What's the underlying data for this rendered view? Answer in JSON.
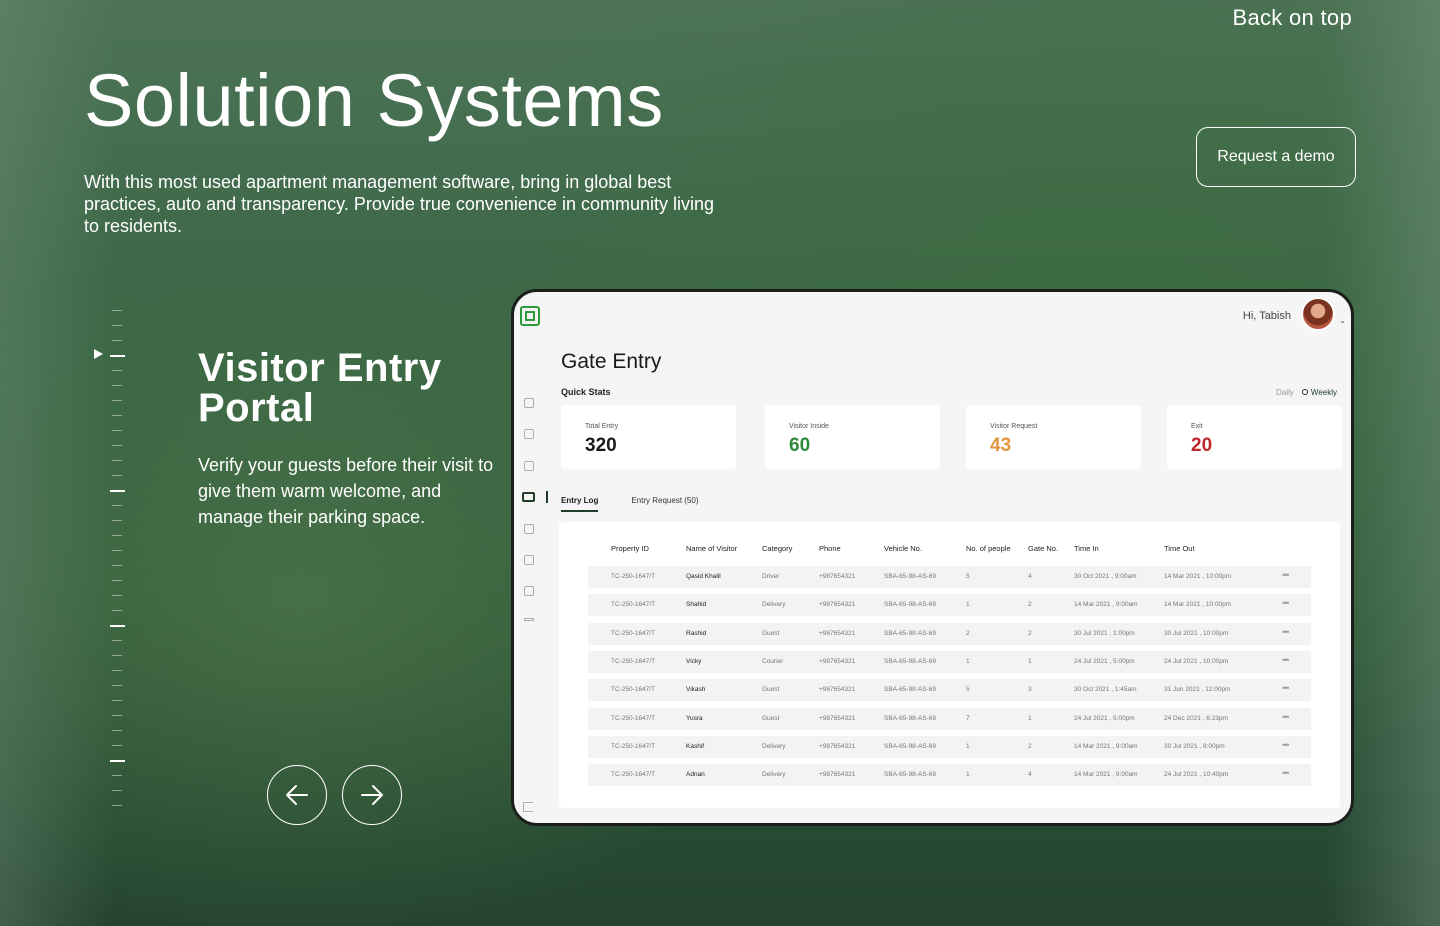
{
  "header": {
    "back_label": "Back on top",
    "title": "Solution Systems",
    "description": "With this most used apartment management software, bring in global best practices, auto and transparency. Provide true convenience in community living to residents.",
    "demo_label": "Request a demo"
  },
  "feature": {
    "title": "Visitor Entry Portal",
    "description": "Verify your guests before their visit to give them warm welcome, and manage their parking space."
  },
  "app": {
    "greeting": "Hi, Tabish",
    "title": "Gate Entry",
    "quick_stats_label": "Quick Stats",
    "period": {
      "daily": "Daily",
      "weekly": "Weekly",
      "selected": "Weekly"
    },
    "stats": [
      {
        "label": "Total Entry",
        "value": "320",
        "color": "#1a1a1a"
      },
      {
        "label": "Visitor Inside",
        "value": "60",
        "color": "#2e8b3a"
      },
      {
        "label": "Visitor Request",
        "value": "43",
        "color": "#e0953f"
      },
      {
        "label": "Exit",
        "value": "20",
        "color": "#c0272d"
      }
    ],
    "tabs": [
      "Entry Log",
      "Entry Request (50)"
    ],
    "active_tab": "Entry Log",
    "columns": [
      "Property ID",
      "Name of Visitor",
      "Category",
      "Phone",
      "Vehicle No.",
      "No. of people",
      "Gate No.",
      "Time In",
      "Time Out"
    ],
    "rows": [
      [
        "TC-250-1647/T",
        "Qasid Khalil",
        "Driver",
        "+987654321",
        "SBA-65-98-AS-69",
        "5",
        "4",
        "30 Oct 2021 , 9:00am",
        "14 Mar 2021 , 10:00pm"
      ],
      [
        "TC-250-1647/T",
        "Shahid",
        "Delivery",
        "+987654321",
        "SBA-65-98-AS-69",
        "1",
        "2",
        "14 Mar 2021 , 9:00am",
        "14 Mar 2021 , 10:00pm"
      ],
      [
        "TC-250-1647/T",
        "Rashid",
        "Guest",
        "+987654321",
        "SBA-65-98-AS-69",
        "2",
        "2",
        "30 Jul 2021 , 1:00pm",
        "30 Jul 2021 , 10:00pm"
      ],
      [
        "TC-250-1647/T",
        "Vicky",
        "Courier",
        "+987654321",
        "SBA-65-98-AS-69",
        "1",
        "1",
        "24  Jul 2021 , 5:00pm",
        "24  Jul 2021 , 10:00pm"
      ],
      [
        "TC-250-1647/T",
        "Vikash",
        "Guest",
        "+987654321",
        "SBA-65-98-AS-69",
        "5",
        "3",
        "30 Oct 2021 , 1:45am",
        "31 Jun 2021 , 12:00pm"
      ],
      [
        "TC-250-1647/T",
        "Yusra",
        "Guest",
        "+987654321",
        "SBA-65-98-AS-69",
        "7",
        "1",
        "24  Jul 2021 , 5:00pm",
        "24 Dec 2021 , 6:23pm"
      ],
      [
        "TC-250-1647/T",
        "Kashif",
        "Delivery",
        "+987654321",
        "SBA-65-98-AS-69",
        "1",
        "2",
        "14 Mar 2021 , 9:00am",
        "30 Jul 2021 , 8:00pm"
      ],
      [
        "TC-250-1647/T",
        "Adnan",
        "Delivery",
        "+987654321",
        "SBA-65-98-AS-69",
        "1",
        "4",
        "14 Mar 2021 , 9:00am",
        "24  Jul 2021 , 10:40pm"
      ]
    ],
    "more_icon": "more-horizontal-icon",
    "sidebar_icons": [
      "dashboard-icon",
      "building-icon",
      "bill-icon",
      "gate-entry-icon",
      "complex-icon",
      "community-icon",
      "document-icon",
      "menu-icon"
    ],
    "active_sidebar": "gate-entry-icon"
  },
  "colors": {
    "accent": "#2e9b3a",
    "dark_green": "#1f3c29"
  }
}
